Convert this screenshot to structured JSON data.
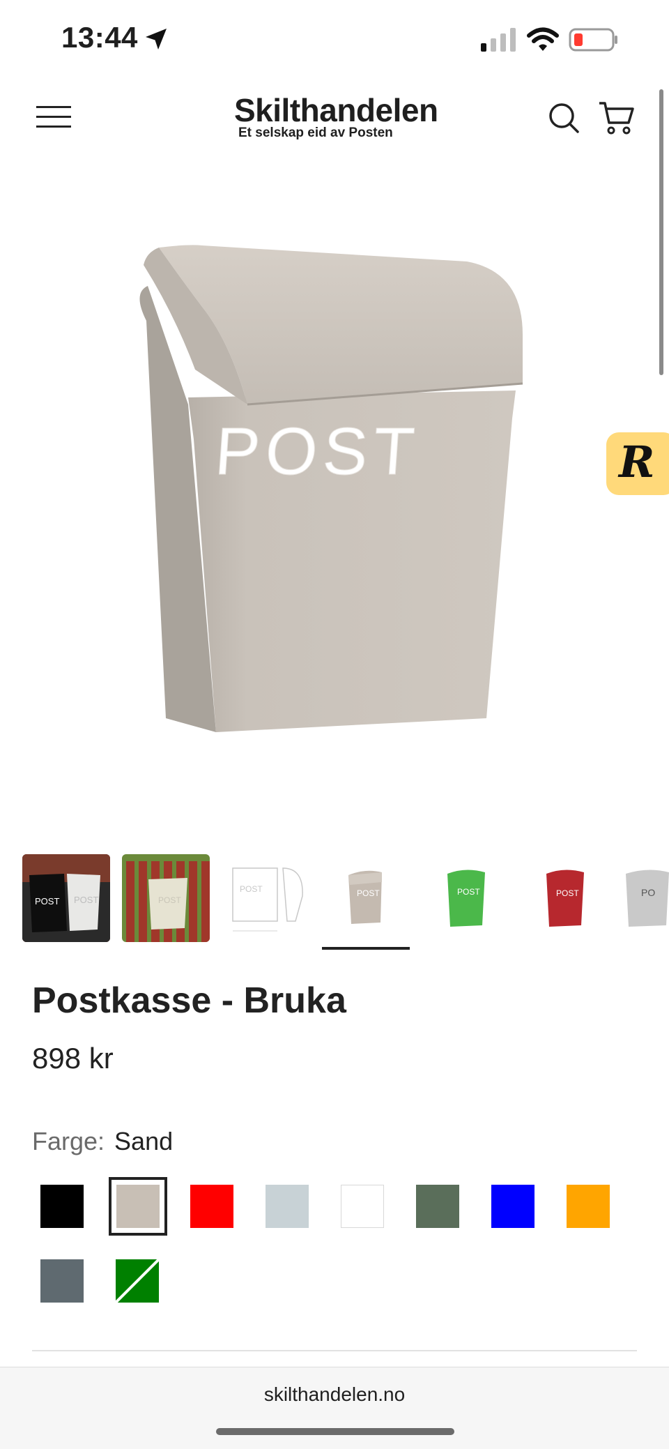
{
  "status_bar": {
    "time": "13:44"
  },
  "header": {
    "brand_name": "Skilthandelen",
    "brand_tagline": "Et selskap eid av Posten"
  },
  "main_image": {
    "mailbox_text": "POST",
    "color": "#c8c1b8"
  },
  "widget": {
    "letter": "R"
  },
  "thumbnails": [
    {
      "name": "thumb-photo-black-white",
      "text": "POST"
    },
    {
      "name": "thumb-photo-fence",
      "text": "POST"
    },
    {
      "name": "thumb-drawing",
      "text": "POST"
    },
    {
      "name": "thumb-sand",
      "text": "POST",
      "color": "#c4bab0",
      "selected": true
    },
    {
      "name": "thumb-green",
      "text": "POST",
      "color": "#4bb84a"
    },
    {
      "name": "thumb-red",
      "text": "POST",
      "color": "#b7282e"
    },
    {
      "name": "thumb-grey",
      "text": "PO",
      "color": "#c9c9c9"
    }
  ],
  "product": {
    "title": "Postkasse - Bruka",
    "price": "898 kr",
    "color_label": "Farge:",
    "color_value": "Sand"
  },
  "swatches": [
    {
      "name": "black",
      "color": "#000000"
    },
    {
      "name": "sand",
      "color": "#c8bfb5",
      "selected": true
    },
    {
      "name": "red",
      "color": "#ff0000"
    },
    {
      "name": "light-grey",
      "color": "#c8d2d6"
    },
    {
      "name": "white",
      "color": "#ffffff"
    },
    {
      "name": "dark-green",
      "color": "#5a6e5a"
    },
    {
      "name": "blue",
      "color": "#0000ff"
    },
    {
      "name": "orange",
      "color": "#ffa500"
    },
    {
      "name": "slate-grey",
      "color": "#5f6a70"
    },
    {
      "name": "green-striped",
      "color": "#008000"
    }
  ],
  "browser": {
    "url": "skilthandelen.no"
  }
}
